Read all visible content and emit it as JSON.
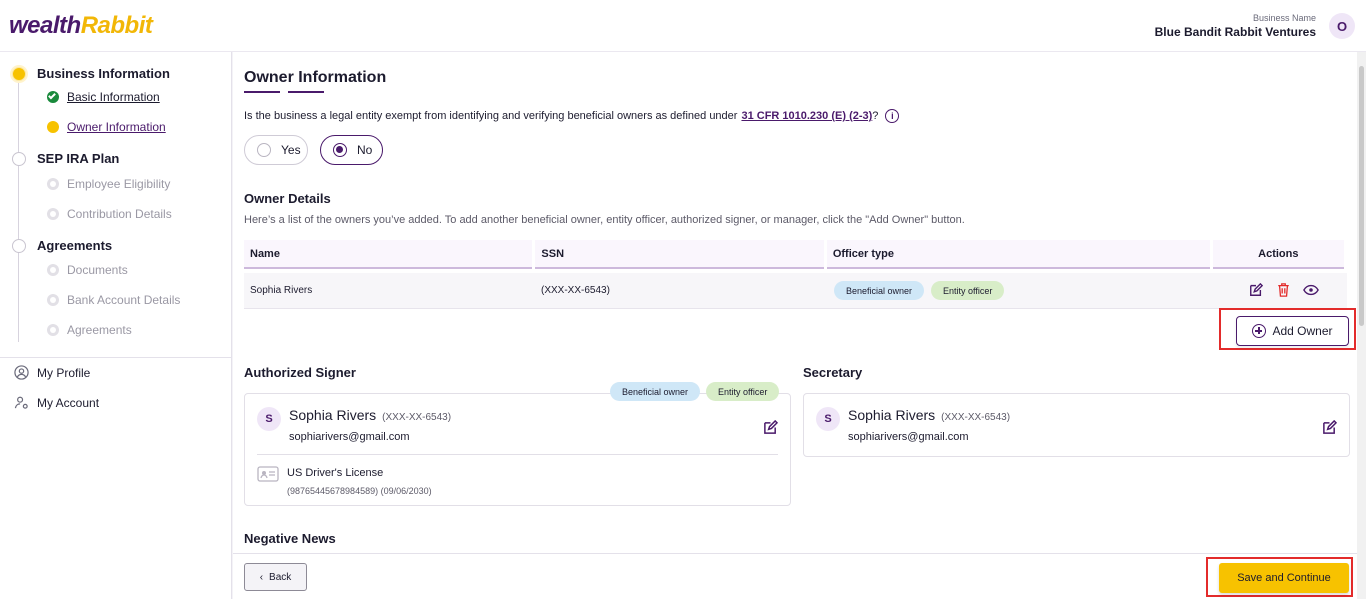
{
  "header": {
    "logo_a": "wealth",
    "logo_b": "Rabbit",
    "business_name_label": "Business Name",
    "business_name": "Blue Bandit Rabbit Ventures",
    "avatar_initial": "O"
  },
  "sidebar": {
    "steps": [
      {
        "label": "Business Information",
        "state": "active"
      },
      {
        "label": "SEP IRA Plan",
        "state": "pending"
      },
      {
        "label": "Agreements",
        "state": "pending"
      }
    ],
    "substeps": [
      {
        "label": "Basic Information",
        "state": "done"
      },
      {
        "label": "Owner Information",
        "state": "current"
      },
      {
        "label": "Employee Eligibility",
        "state": "pending"
      },
      {
        "label": "Contribution Details",
        "state": "pending"
      },
      {
        "label": "Documents",
        "state": "pending"
      },
      {
        "label": "Bank Account Details",
        "state": "pending"
      },
      {
        "label": "Agreements",
        "state": "pending"
      }
    ],
    "nav": [
      {
        "label": "My Profile",
        "icon": "user-circle-icon"
      },
      {
        "label": "My Account",
        "icon": "user-settings-icon"
      }
    ]
  },
  "main": {
    "title": "Owner Information",
    "question_text": "Is the business a legal entity exempt from identifying and verifying beneficial owners as defined under",
    "question_link": "31 CFR 1010.230 (E) (2-3)",
    "question_suffix": "?",
    "radio_yes": "Yes",
    "radio_no": "No",
    "selected": "No",
    "owner_details_title": "Owner Details",
    "owner_details_desc": "Here’s a list of the owners you’ve added. To add another beneficial owner, entity officer, authorized signer, or manager, click the \"Add Owner\" button.",
    "table": {
      "headers": [
        "Name",
        "SSN",
        "Officer type",
        "Actions"
      ],
      "rows": [
        {
          "name": "Sophia Rivers",
          "ssn": "(XXX-XX-6543)",
          "badges": [
            "Beneficial owner",
            "Entity officer"
          ]
        }
      ]
    },
    "add_owner_label": "Add Owner",
    "authorized_signer": {
      "title": "Authorized Signer",
      "initial": "S",
      "name": "Sophia Rivers",
      "ssn": "(XXX-XX-6543)",
      "email": "sophiarivers@gmail.com",
      "badges": [
        "Beneficial owner",
        "Entity officer"
      ],
      "license_type": "US Driver's License",
      "license_detail": "(98765445678984589) (09/06/2030)"
    },
    "secretary": {
      "title": "Secretary",
      "initial": "S",
      "name": "Sophia Rivers",
      "ssn": "(XXX-XX-6543)",
      "email": "sophiarivers@gmail.com"
    },
    "negative_news_title": "Negative News"
  },
  "footer": {
    "back_label": "Back",
    "save_label": "Save and Continue"
  },
  "colors": {
    "brand_purple": "#4a1a6b",
    "accent_yellow": "#f7c200",
    "highlight_red": "#e32b2b"
  }
}
